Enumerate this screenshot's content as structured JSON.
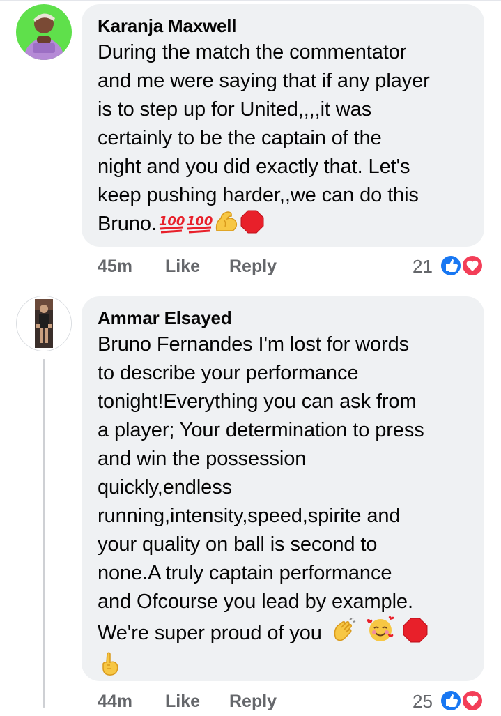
{
  "comments": [
    {
      "author": "Karanja Maxwell",
      "lines": [
        "During the match the commentator",
        "and me were saying that if any player",
        "is to step up for United,,,,it was",
        "certainly to be the captain of the",
        "night and you did exactly that. Let's",
        "keep pushing harder,,we can do this",
        "Bruno."
      ],
      "emojis": [
        "hundred-points-icon",
        "hundred-points-icon",
        "flexed-biceps-icon",
        "stop-sign-icon"
      ],
      "time": "45m",
      "like": "Like",
      "reply": "Reply",
      "reaction_count": "21"
    },
    {
      "author": "Ammar Elsayed",
      "lines": [
        "Bruno Fernandes I'm lost for words",
        "to describe your performance",
        "tonight!Everything you can ask from",
        "a player; Your determination to press",
        "and win the possession",
        "quickly,endless",
        "running,intensity,speed,spirite and",
        "your quality on ball is second to",
        "none.A truly captain performance",
        "and Ofcourse you lead by example.",
        "We're super proud of you"
      ],
      "emojis": [
        "clapping-hands-icon",
        "smiling-face-with-hearts-icon",
        "stop-sign-icon",
        "hand-pointing-up-icon"
      ],
      "time": "44m",
      "like": "Like",
      "reply": "Reply",
      "reaction_count": "25"
    }
  ],
  "colors": {
    "bubble": "#eff1f3",
    "meta_text": "#65676b",
    "like_blue": "#1877f2",
    "love_red": "#f33e58"
  }
}
